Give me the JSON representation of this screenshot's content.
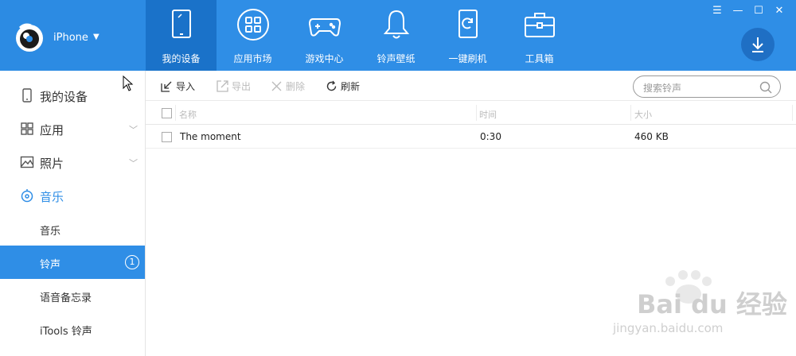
{
  "header": {
    "device_name": "iPhone",
    "nav": [
      {
        "label": "我的设备",
        "icon": "tablet-icon"
      },
      {
        "label": "应用市场",
        "icon": "apps-grid-icon"
      },
      {
        "label": "游戏中心",
        "icon": "gamepad-icon"
      },
      {
        "label": "铃声壁纸",
        "icon": "bell-icon"
      },
      {
        "label": "一键刷机",
        "icon": "refresh-phone-icon"
      },
      {
        "label": "工具箱",
        "icon": "toolbox-icon"
      }
    ],
    "active_nav": 0
  },
  "sidebar": {
    "items": [
      {
        "label": "我的设备",
        "icon": "device-icon"
      },
      {
        "label": "应用",
        "icon": "apps-icon"
      },
      {
        "label": "照片",
        "icon": "photo-icon"
      },
      {
        "label": "音乐",
        "icon": "music-icon"
      }
    ],
    "music_sub": [
      {
        "label": "音乐"
      },
      {
        "label": "铃声",
        "badge": "1"
      },
      {
        "label": "语音备忘录"
      },
      {
        "label": "iTools 铃声"
      }
    ],
    "active_sub": 1
  },
  "toolbar": {
    "import_label": "导入",
    "export_label": "导出",
    "delete_label": "删除",
    "refresh_label": "刷新",
    "search_placeholder": "搜索铃声"
  },
  "table": {
    "columns": [
      "名称",
      "时间",
      "大小"
    ],
    "rows": [
      {
        "name": "The moment",
        "time": "0:30",
        "size": "460 KB"
      }
    ]
  },
  "watermark": {
    "brand": "Bai du 经验",
    "url": "jingyan.baidu.com"
  },
  "colors": {
    "accent": "#2f8ee6",
    "nav_active": "#1a72c9"
  }
}
